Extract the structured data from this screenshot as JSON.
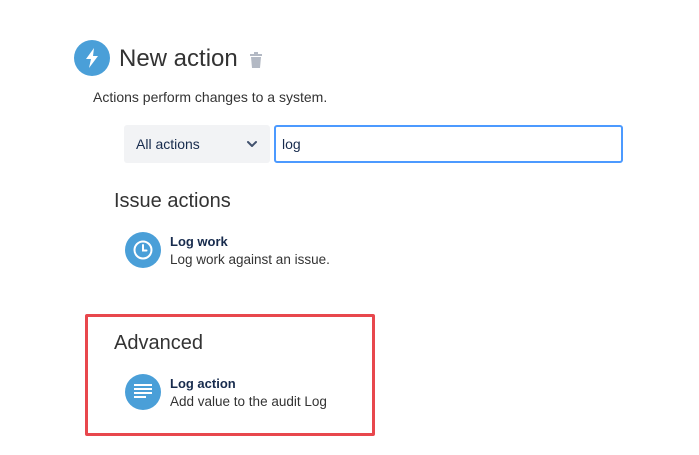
{
  "header": {
    "title": "New action",
    "icon": "lightning-icon",
    "delete_icon": "trash-icon",
    "subtitle": "Actions perform changes to a system."
  },
  "filter": {
    "select_value": "All actions",
    "search_value": "log"
  },
  "sections": [
    {
      "title": "Issue actions",
      "items": [
        {
          "name": "Log work",
          "description": "Log work against an issue.",
          "icon": "clock-icon"
        }
      ]
    },
    {
      "title": "Advanced",
      "items": [
        {
          "name": "Log action",
          "description": "Add value to the audit Log",
          "icon": "text-lines-icon"
        }
      ]
    }
  ],
  "colors": {
    "icon_blue": "#4a9fd8",
    "focus_border": "#4c9aff",
    "highlight_red": "#e8474d"
  }
}
